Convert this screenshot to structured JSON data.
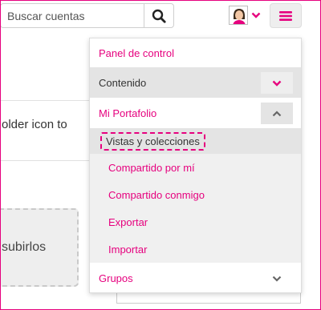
{
  "header": {
    "search_placeholder": "Buscar cuentas"
  },
  "background": {
    "truncated_text": "older icon to",
    "dropzone_text": "subirlos"
  },
  "menu": {
    "items": [
      {
        "label": "Panel de control"
      },
      {
        "label": "Contenido",
        "state": "collapsed"
      },
      {
        "label": "Mi Portafolio",
        "state": "expanded"
      },
      {
        "label": "Grupos",
        "state": "collapsed"
      }
    ],
    "portfolio_subitems": [
      {
        "label": "Vistas y colecciones",
        "selected": true
      },
      {
        "label": "Compartido por mí"
      },
      {
        "label": "Compartido conmigo"
      },
      {
        "label": "Exportar"
      },
      {
        "label": "Importar"
      }
    ]
  },
  "colors": {
    "accent": "#e6007e",
    "highlight_bg": "#e4e4e4",
    "submenu_bg": "#f0f0f0"
  },
  "icons": [
    "search-icon",
    "avatar",
    "chevron-down-icon",
    "hamburger-menu-icon",
    "chevron-up-icon"
  ]
}
